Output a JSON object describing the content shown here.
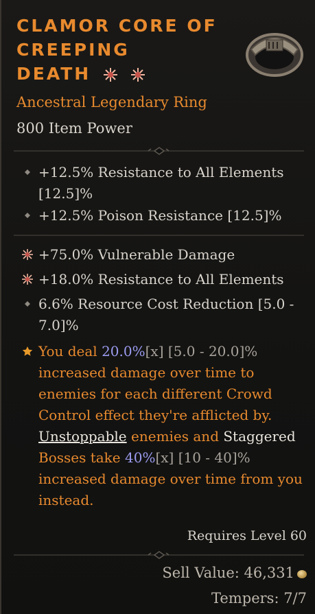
{
  "item": {
    "name_lines": [
      "Clamor Core of",
      "Creeping",
      "Death"
    ],
    "type": "Ancestral Legendary Ring",
    "power": "800 Item Power",
    "icon": "ring-icon"
  },
  "implicits": [
    {
      "text": "+12.5% Resistance to All Elements",
      "range": "[12.5]%",
      "bullet": "diamond-icon"
    },
    {
      "text": "+12.5% Poison Resistance [12.5]%",
      "bullet": "diamond-icon"
    }
  ],
  "affixes": [
    {
      "text": "+75.0% Vulnerable Damage",
      "bullet": "greater-affix-icon"
    },
    {
      "text": "+18.0% Resistance to All Elements",
      "bullet": "greater-affix-icon"
    },
    {
      "text": "6.6% Resource Cost Reduction [5.0 -",
      "line2": "7.0]%",
      "bullet": "diamond-icon"
    }
  ],
  "aspect": {
    "bullet": "star-icon",
    "p1": "You deal ",
    "v1": "20.0%",
    "m1": "[x]",
    "r1": " [5.0 - 20.0]%",
    "l2": "increased damage over time to",
    "l3": "enemies for each different Crowd",
    "l4": "Control effect they're afflicted by.",
    "kw1": "Unstoppable",
    "l5mid": " enemies and ",
    "kw2": "Staggered",
    "l6a": "Bosses take ",
    "v2": "40%",
    "m2": "[x]",
    "r2": " [10 - 40]%",
    "l7": "increased damage over time from you",
    "l8": "instead."
  },
  "footer": {
    "requires": "Requires Level 60",
    "sell_label": "Sell Value: 46,331",
    "tempers": "Tempers: 7/7"
  },
  "colors": {
    "legendary_orange": "#e88a2e",
    "affix_text": "#d9d4cc",
    "value_blue": "#9b9bf0"
  }
}
